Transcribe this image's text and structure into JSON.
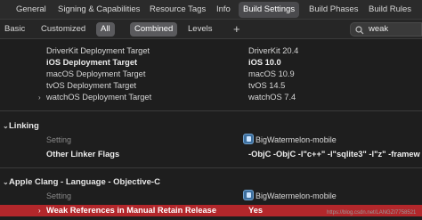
{
  "tabs": [
    "General",
    "Signing & Capabilities",
    "Resource Tags",
    "Info",
    "Build Settings",
    "Build Phases",
    "Build Rules"
  ],
  "active_tab": "Build Settings",
  "filter": {
    "basic": "Basic",
    "customized": "Customized",
    "all": "All",
    "combined": "Combined",
    "levels": "Levels",
    "add": "+",
    "search_value": "weak"
  },
  "deployment_rows": [
    {
      "setting": "DriverKit Deployment Target",
      "value": "DriverKit 20.4"
    },
    {
      "setting": "iOS Deployment Target",
      "value": "iOS 10.0"
    },
    {
      "setting": "macOS Deployment Target",
      "value": "macOS 10.9"
    },
    {
      "setting": "tvOS Deployment Target",
      "value": "tvOS 14.5"
    },
    {
      "setting": "watchOS Deployment Target",
      "value": "watchOS 7.4"
    }
  ],
  "linking": {
    "title": "Linking",
    "header_setting": "Setting",
    "target_name": "BigWatermelon-mobile",
    "row_setting": "Other Linker Flags",
    "row_value": "-ObjC  -ObjC -l\"c++\" -l\"sqlite3\" -l\"z\" -framew"
  },
  "clang": {
    "title": "Apple Clang - Language - Objective-C",
    "header_setting": "Setting",
    "target_name": "BigWatermelon-mobile",
    "row_setting": "Weak References in Manual Retain Release",
    "row_value": "Yes"
  },
  "watermark": "https://blog.csdn.net/LANGZI7758521",
  "colors": {
    "highlight": "#b3272b",
    "active_tab": "#4a4a4d"
  }
}
